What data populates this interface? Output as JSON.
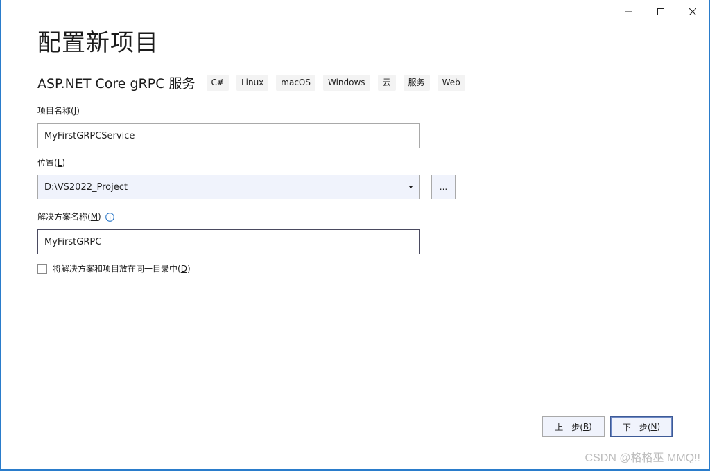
{
  "window_controls": {
    "minimize_icon": "minimize-icon",
    "maximize_icon": "maximize-icon",
    "close_icon": "close-icon"
  },
  "page": {
    "title": "配置新项目"
  },
  "template": {
    "name": "ASP.NET Core gRPC 服务",
    "tags": [
      "C#",
      "Linux",
      "macOS",
      "Windows",
      "云",
      "服务",
      "Web"
    ]
  },
  "project_name": {
    "label_prefix": "项目名称(",
    "label_key": "J",
    "label_suffix": ")",
    "value": "MyFirstGRPCService"
  },
  "location": {
    "label_prefix": "位置(",
    "label_key": "L",
    "label_suffix": ")",
    "value": "D:\\VS2022_Project",
    "browse_label": "..."
  },
  "solution_name": {
    "label_prefix": "解决方案名称(",
    "label_key": "M",
    "label_suffix": ")",
    "value": "MyFirstGRPC"
  },
  "same_directory": {
    "label_prefix": "将解决方案和项目放在同一目录中(",
    "label_key": "D",
    "label_suffix": ")",
    "checked": false
  },
  "footer": {
    "back_prefix": "上一步(",
    "back_key": "B",
    "back_suffix": ")",
    "next_prefix": "下一步(",
    "next_key": "N",
    "next_suffix": ")"
  },
  "watermark": "CSDN @格格巫 MMQ!!"
}
